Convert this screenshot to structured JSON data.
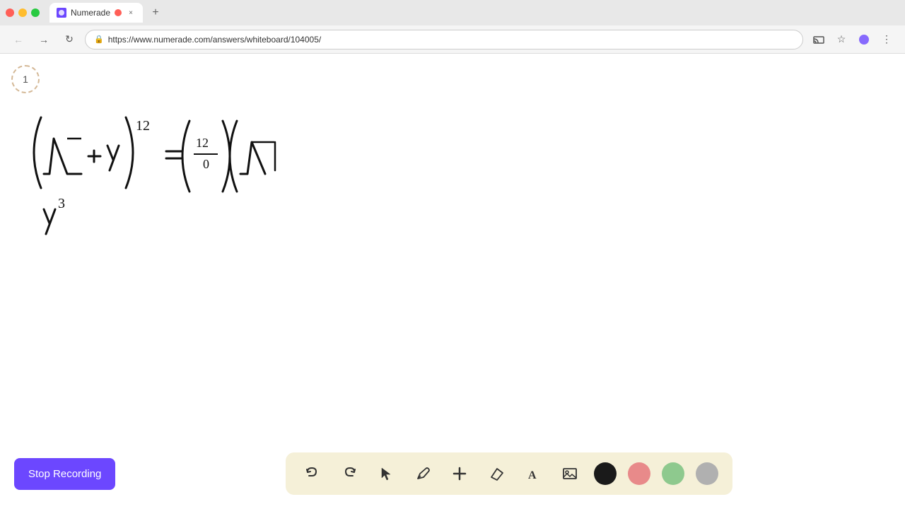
{
  "browser": {
    "tab_title": "Numerade",
    "url": "https://www.numerade.com/answers/whiteboard/104005/",
    "traffic_lights": [
      "red",
      "yellow",
      "green"
    ]
  },
  "nav": {
    "back_label": "←",
    "forward_label": "→",
    "reload_label": "↻",
    "lock_icon": "🔒"
  },
  "page": {
    "step_number": "1"
  },
  "toolbar": {
    "stop_recording_label": "Stop Recording",
    "buttons": [
      {
        "name": "undo",
        "icon": "↩",
        "label": "Undo"
      },
      {
        "name": "redo",
        "icon": "↪",
        "label": "Redo"
      },
      {
        "name": "select",
        "icon": "▷",
        "label": "Select"
      },
      {
        "name": "pen",
        "icon": "✏",
        "label": "Pen"
      },
      {
        "name": "add",
        "icon": "+",
        "label": "Add"
      },
      {
        "name": "eraser",
        "icon": "◫",
        "label": "Eraser"
      },
      {
        "name": "text",
        "icon": "A",
        "label": "Text"
      },
      {
        "name": "image",
        "icon": "▦",
        "label": "Image"
      }
    ],
    "colors": [
      {
        "name": "black",
        "hex": "#1a1a1a"
      },
      {
        "name": "pink",
        "hex": "#e88a8a"
      },
      {
        "name": "green",
        "hex": "#8ec98e"
      },
      {
        "name": "gray",
        "hex": "#b0b0b0"
      }
    ]
  }
}
